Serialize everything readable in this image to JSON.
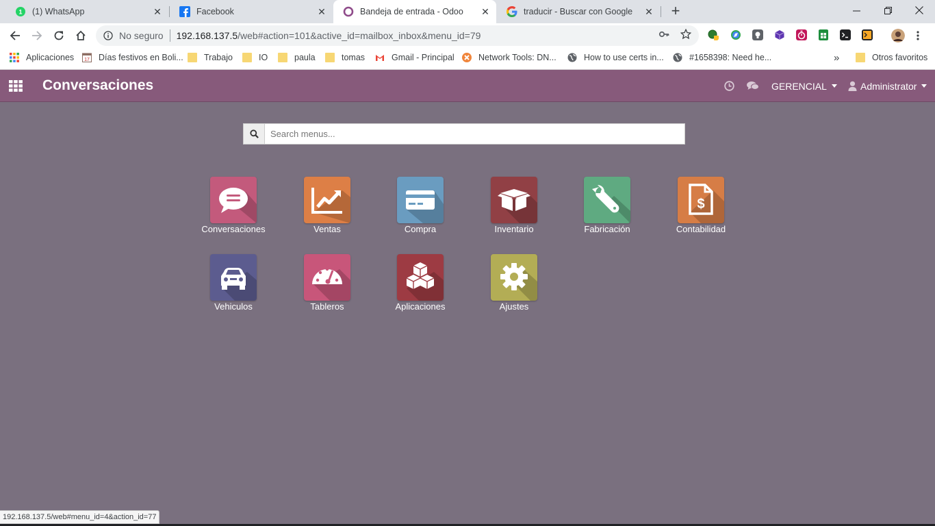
{
  "browser": {
    "tabs": [
      {
        "title": "(1) WhatsApp",
        "icon": "whatsapp-icon",
        "active": false
      },
      {
        "title": "Facebook",
        "icon": "facebook-icon",
        "active": false
      },
      {
        "title": "Bandeja de entrada - Odoo",
        "icon": "odoo-icon",
        "active": true
      },
      {
        "title": "traducir - Buscar con Google",
        "icon": "google-icon",
        "active": false
      }
    ],
    "new_tab": "+",
    "address": {
      "security": "No seguro",
      "host": "192.168.137.5",
      "path": "/web#action=101&active_id=mailbox_inbox&menu_id=79"
    },
    "bookmarks": [
      {
        "label": "Aplicaciones",
        "icon": "apps-grid-icon"
      },
      {
        "label": "Días festivos en Boli...",
        "icon": "calendar-icon"
      },
      {
        "label": "Trabajo",
        "icon": "folder-icon"
      },
      {
        "label": "IO",
        "icon": "folder-icon"
      },
      {
        "label": "paula",
        "icon": "folder-icon"
      },
      {
        "label": "tomas",
        "icon": "folder-icon"
      },
      {
        "label": "Gmail - Principal",
        "icon": "gmail-icon"
      },
      {
        "label": "Network Tools: DN...",
        "icon": "network-tools-icon"
      },
      {
        "label": "How to use certs in...",
        "icon": "globe-icon"
      },
      {
        "label": "#1658398: Need he...",
        "icon": "globe-icon"
      }
    ],
    "overflow": "»",
    "other_bookmarks": "Otros favoritos",
    "status_url": "192.168.137.5/web#menu_id=4&action_id=77"
  },
  "odoo": {
    "title": "Conversaciones",
    "company": "GERENCIAL",
    "user": "Administrator",
    "search_placeholder": "Search menus...",
    "apps": [
      {
        "label": "Conversaciones",
        "icon": "chat-bubble-icon",
        "color": "#c35a7c"
      },
      {
        "label": "Ventas",
        "icon": "sales-chart-icon",
        "color": "#dd7f46"
      },
      {
        "label": "Compra",
        "icon": "credit-card-icon",
        "color": "#6a9cc0"
      },
      {
        "label": "Inventario",
        "icon": "box-icon",
        "color": "#914045"
      },
      {
        "label": "Fabricación",
        "icon": "wrench-icon",
        "color": "#5faa81"
      },
      {
        "label": "Contabilidad",
        "icon": "invoice-icon",
        "color": "#d67d46"
      },
      {
        "label": "Vehiculos",
        "icon": "car-icon",
        "color": "#5c5c8f"
      },
      {
        "label": "Tableros",
        "icon": "dashboard-gauge-icon",
        "color": "#c8567a"
      },
      {
        "label": "Aplicaciones",
        "icon": "cubes-icon",
        "color": "#9d3b43"
      },
      {
        "label": "Ajustes",
        "icon": "gear-icon",
        "color": "#b3ad55"
      }
    ]
  }
}
